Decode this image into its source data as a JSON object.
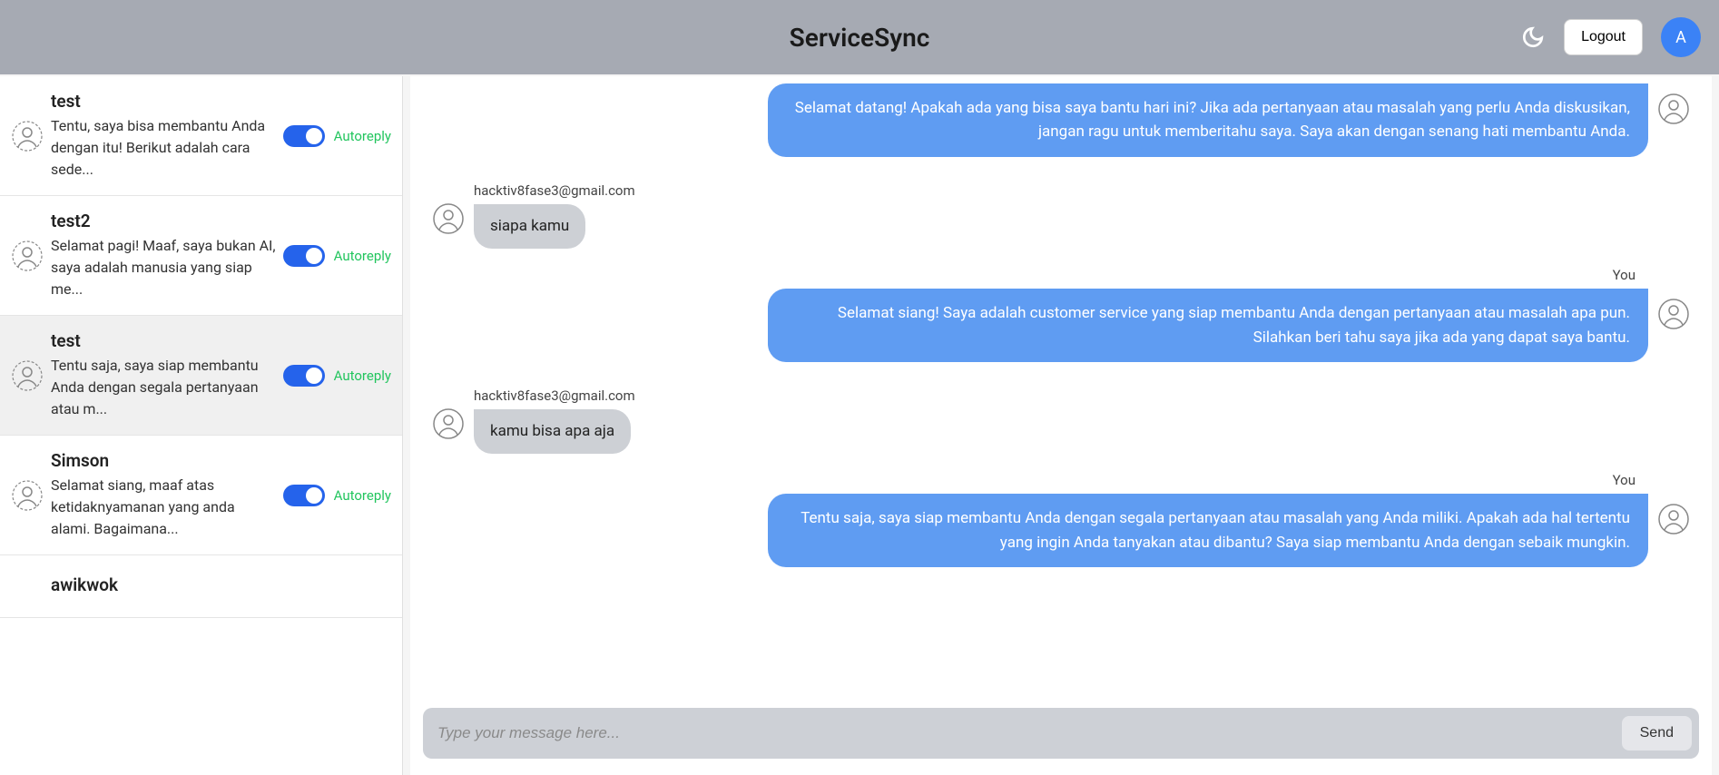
{
  "header": {
    "title": "ServiceSync",
    "logout_label": "Logout",
    "avatar_initial": "A"
  },
  "sidebar": {
    "autoreply_label": "Autoreply",
    "conversations": [
      {
        "name": "test",
        "preview": "Tentu, saya bisa membantu Anda dengan itu! Berikut adalah cara sede...",
        "active": false
      },
      {
        "name": "test2",
        "preview": "Selamat pagi! Maaf, saya bukan AI, saya adalah manusia yang siap me...",
        "active": false
      },
      {
        "name": "test",
        "preview": "Tentu saja, saya siap membantu Anda dengan segala pertanyaan atau m...",
        "active": true
      },
      {
        "name": "Simson",
        "preview": "Selamat siang, maaf atas ketidaknyamanan yang anda alami. Bagaimana...",
        "active": false
      },
      {
        "name": "awikwok",
        "preview": "",
        "active": false
      }
    ]
  },
  "chat": {
    "you_label": "You",
    "other_sender": "hacktiv8fase3@gmail.com",
    "messages": [
      {
        "from": "you",
        "text": "Selamat datang! Apakah ada yang bisa saya bantu hari ini? Jika ada pertanyaan atau masalah yang perlu Anda diskusikan, jangan ragu untuk memberitahu saya. Saya akan dengan senang hati membantu Anda."
      },
      {
        "from": "other",
        "text": "siapa kamu"
      },
      {
        "from": "you",
        "text": "Selamat siang! Saya adalah customer service yang siap membantu Anda dengan pertanyaan atau masalah apa pun. Silahkan beri tahu saya jika ada yang dapat saya bantu."
      },
      {
        "from": "other",
        "text": "kamu bisa apa aja"
      },
      {
        "from": "you",
        "text": "Tentu saja, saya siap membantu Anda dengan segala pertanyaan atau masalah yang Anda miliki. Apakah ada hal tertentu yang ingin Anda tanyakan atau dibantu? Saya siap membantu Anda dengan sebaik mungkin."
      }
    ],
    "composer": {
      "placeholder": "Type your message here...",
      "send_label": "Send"
    }
  }
}
